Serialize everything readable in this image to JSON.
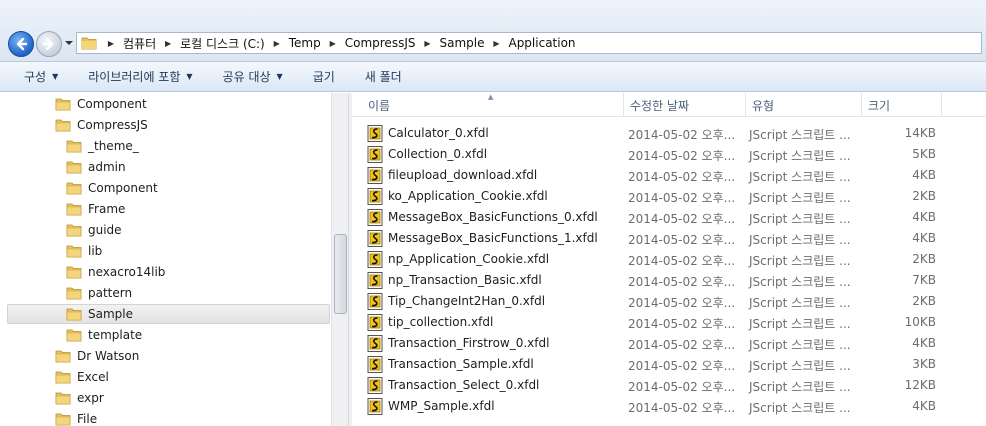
{
  "address": {
    "crumbs": [
      "컴퓨터",
      "로컬 디스크 (C:)",
      "Temp",
      "CompressJS",
      "Sample",
      "Application"
    ]
  },
  "toolbar": {
    "organize": "구성",
    "include_in_library": "라이브러리에 포함",
    "share_with": "공유 대상",
    "burn": "굽기",
    "new_folder": "새 폴더"
  },
  "tree": [
    {
      "label": "Component",
      "level": 0
    },
    {
      "label": "CompressJS",
      "level": 0
    },
    {
      "label": "_theme_",
      "level": 1
    },
    {
      "label": "admin",
      "level": 1
    },
    {
      "label": "Component",
      "level": 1
    },
    {
      "label": "Frame",
      "level": 1
    },
    {
      "label": "guide",
      "level": 1
    },
    {
      "label": "lib",
      "level": 1
    },
    {
      "label": "nexacro14lib",
      "level": 1
    },
    {
      "label": "pattern",
      "level": 1
    },
    {
      "label": "Sample",
      "level": 1,
      "selected": true
    },
    {
      "label": "template",
      "level": 1
    },
    {
      "label": "Dr Watson",
      "level": 0
    },
    {
      "label": "Excel",
      "level": 0
    },
    {
      "label": "expr",
      "level": 0
    },
    {
      "label": "File",
      "level": 0
    }
  ],
  "columns": {
    "name": "이름",
    "modified": "수정한 날짜",
    "type": "유형",
    "size": "크기"
  },
  "files": [
    {
      "name": "Calculator_0.xfdl",
      "date": "2014-05-02 오후...",
      "type": "JScript 스크립트 ...",
      "size": "14KB"
    },
    {
      "name": "Collection_0.xfdl",
      "date": "2014-05-02 오후...",
      "type": "JScript 스크립트 ...",
      "size": "5KB"
    },
    {
      "name": "fileupload_download.xfdl",
      "date": "2014-05-02 오후...",
      "type": "JScript 스크립트 ...",
      "size": "4KB"
    },
    {
      "name": "ko_Application_Cookie.xfdl",
      "date": "2014-05-02 오후...",
      "type": "JScript 스크립트 ...",
      "size": "2KB"
    },
    {
      "name": "MessageBox_BasicFunctions_0.xfdl",
      "date": "2014-05-02 오후...",
      "type": "JScript 스크립트 ...",
      "size": "4KB"
    },
    {
      "name": "MessageBox_BasicFunctions_1.xfdl",
      "date": "2014-05-02 오후...",
      "type": "JScript 스크립트 ...",
      "size": "4KB"
    },
    {
      "name": "np_Application_Cookie.xfdl",
      "date": "2014-05-02 오후...",
      "type": "JScript 스크립트 ...",
      "size": "2KB"
    },
    {
      "name": "np_Transaction_Basic.xfdl",
      "date": "2014-05-02 오후...",
      "type": "JScript 스크립트 ...",
      "size": "7KB"
    },
    {
      "name": "Tip_ChangeInt2Han_0.xfdl",
      "date": "2014-05-02 오후...",
      "type": "JScript 스크립트 ...",
      "size": "2KB"
    },
    {
      "name": "tip_collection.xfdl",
      "date": "2014-05-02 오후...",
      "type": "JScript 스크립트 ...",
      "size": "10KB"
    },
    {
      "name": "Transaction_Firstrow_0.xfdl",
      "date": "2014-05-02 오후...",
      "type": "JScript 스크립트 ...",
      "size": "4KB"
    },
    {
      "name": "Transaction_Sample.xfdl",
      "date": "2014-05-02 오후...",
      "type": "JScript 스크립트 ...",
      "size": "3KB"
    },
    {
      "name": "Transaction_Select_0.xfdl",
      "date": "2014-05-02 오후...",
      "type": "JScript 스크립트 ...",
      "size": "12KB"
    },
    {
      "name": "WMP_Sample.xfdl",
      "date": "2014-05-02 오후...",
      "type": "JScript 스크립트 ...",
      "size": "4KB"
    }
  ],
  "colors": {
    "folder": "#e9c25a",
    "selection": "#e6e6e6",
    "header_text": "#4c607a"
  },
  "icons": {
    "back": "back-arrow-icon",
    "forward": "forward-arrow-icon",
    "folder": "folder-icon",
    "script_file": "jscript-file-icon"
  }
}
